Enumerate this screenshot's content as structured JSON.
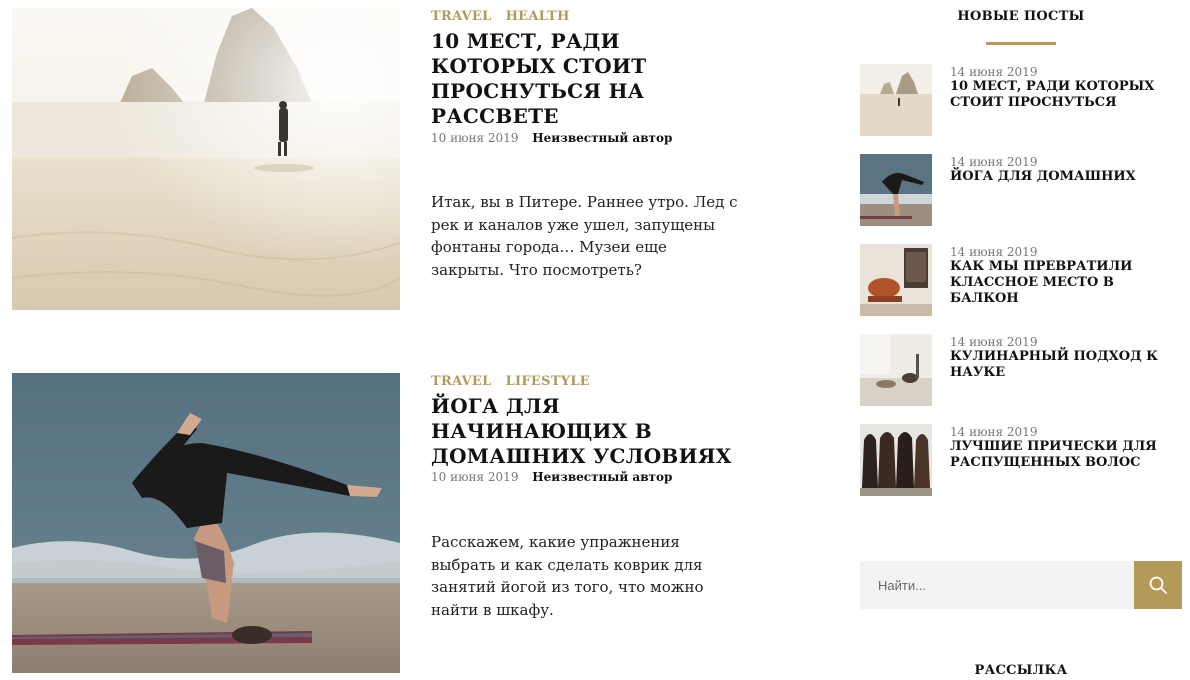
{
  "posts": [
    {
      "categories": [
        "TRAVEL",
        "HEALTH"
      ],
      "title": "10 мест, ради которых стоит проснуться на рассвете",
      "date": "10 июня 2019",
      "author": "Неизвестный автор",
      "excerpt": "Итак, вы в Питере. Раннее утро. Лед с рек и каналов уже ушел, запущены фонтаны города… Музеи еще закрыты. Что посмотреть?"
    },
    {
      "categories": [
        "TRAVEL",
        "LIFESTYLE"
      ],
      "title": "Йога для начинающих в домашних условиях",
      "date": "10 июня 2019",
      "author": "Неизвестный автор",
      "excerpt": "Расскажем, какие упражнения выбрать и как сделать коврик для занятий йогой из того, что можно найти в шкафу."
    }
  ],
  "sidebar": {
    "new_posts_title": "НОВЫЕ ПОСТЫ",
    "recent": [
      {
        "date": "14 июня 2019",
        "title": "10 мест, ради которых стоит проснуться"
      },
      {
        "date": "14 июня 2019",
        "title": "Йога для домашних"
      },
      {
        "date": "14 июня 2019",
        "title": "Как мы превратили классное место в балкон"
      },
      {
        "date": "14 июня 2019",
        "title": "Кулинарный подход к науке"
      },
      {
        "date": "14 июня 2019",
        "title": "Лучшие прически для распущенных волос"
      }
    ],
    "search": {
      "placeholder": "Найти..."
    },
    "newsletter_title": "РАССЫЛКА"
  },
  "colors": {
    "accent": "#b49a58",
    "search_bg": "#f3f4f2"
  },
  "icons": {
    "search_button": "search-icon"
  }
}
